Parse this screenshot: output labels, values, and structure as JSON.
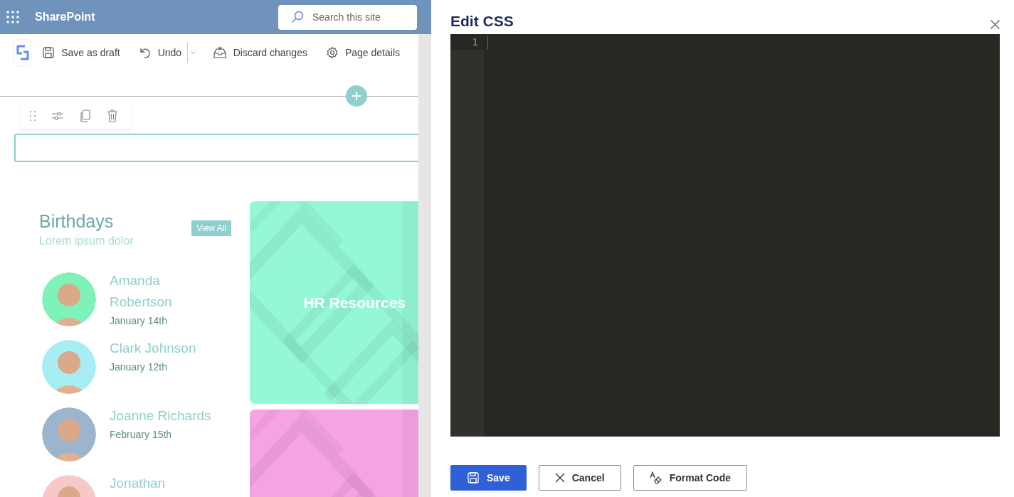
{
  "header": {
    "app_name": "SharePoint",
    "search": {
      "placeholder": "Search this site"
    }
  },
  "toolbar": [
    {
      "label": "Save as draft",
      "kind": "save"
    },
    {
      "label": "Undo",
      "kind": "undo"
    },
    {
      "label": "Discard changes",
      "kind": "discard"
    },
    {
      "label": "Page details",
      "kind": "gear"
    }
  ],
  "birthdays": {
    "title": "Birthdays",
    "subtitle": "Lorem ipsum dolor",
    "button": "View All",
    "people": [
      {
        "name": "Amanda Robertson",
        "date": "January 14th",
        "color": "#7ef2b8"
      },
      {
        "name": "Clark Johnson",
        "date": "January 12th",
        "color": "#a6eef2"
      },
      {
        "name": "Joanne Richards",
        "date": "February 15th",
        "color": "#9cb4cc"
      },
      {
        "name": "Jonathan",
        "color": "#f7c8c8"
      }
    ]
  },
  "tiles": [
    {
      "title": "HR Resources",
      "color": "#94f7d8"
    },
    {
      "color": "#f5a3e3"
    }
  ],
  "panel": {
    "title": "Edit CSS",
    "editor": {
      "line_numbers": [
        "1"
      ]
    },
    "buttons": [
      {
        "label": "Save",
        "kind": "primary"
      },
      {
        "label": "Cancel",
        "kind": "cancel"
      },
      {
        "label": "Format Code",
        "kind": "format"
      }
    ]
  }
}
